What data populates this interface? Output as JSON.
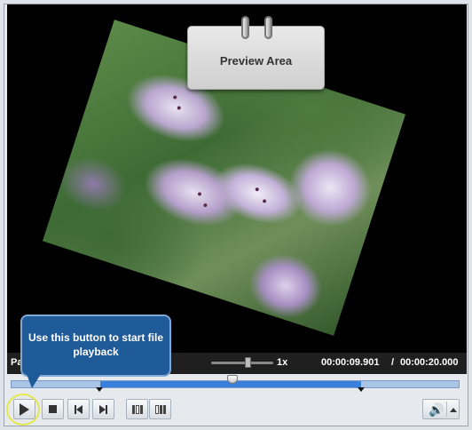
{
  "preview": {
    "callout_label": "Preview Area"
  },
  "status": {
    "label": "Pa",
    "speed": "1x",
    "current_time": "00:00:09.901",
    "separator": "/",
    "total_time": "00:00:20.000"
  },
  "timeline": {
    "playhead_fraction": 0.495
  },
  "controls": {
    "play_icon": "play-icon",
    "stop_icon": "stop-icon",
    "prev_icon": "previous-frame-icon",
    "next_icon": "next-frame-icon",
    "split_icon": "split-icon",
    "trim_icon": "trim-icon",
    "volume_icon": "volume-icon"
  },
  "tooltip": {
    "text": "Use this button to start file playback"
  },
  "colors": {
    "timeline_selection": "#3b7fdc",
    "tooltip_bg": "#1f5a99",
    "highlight_ring": "#e4e84a"
  }
}
